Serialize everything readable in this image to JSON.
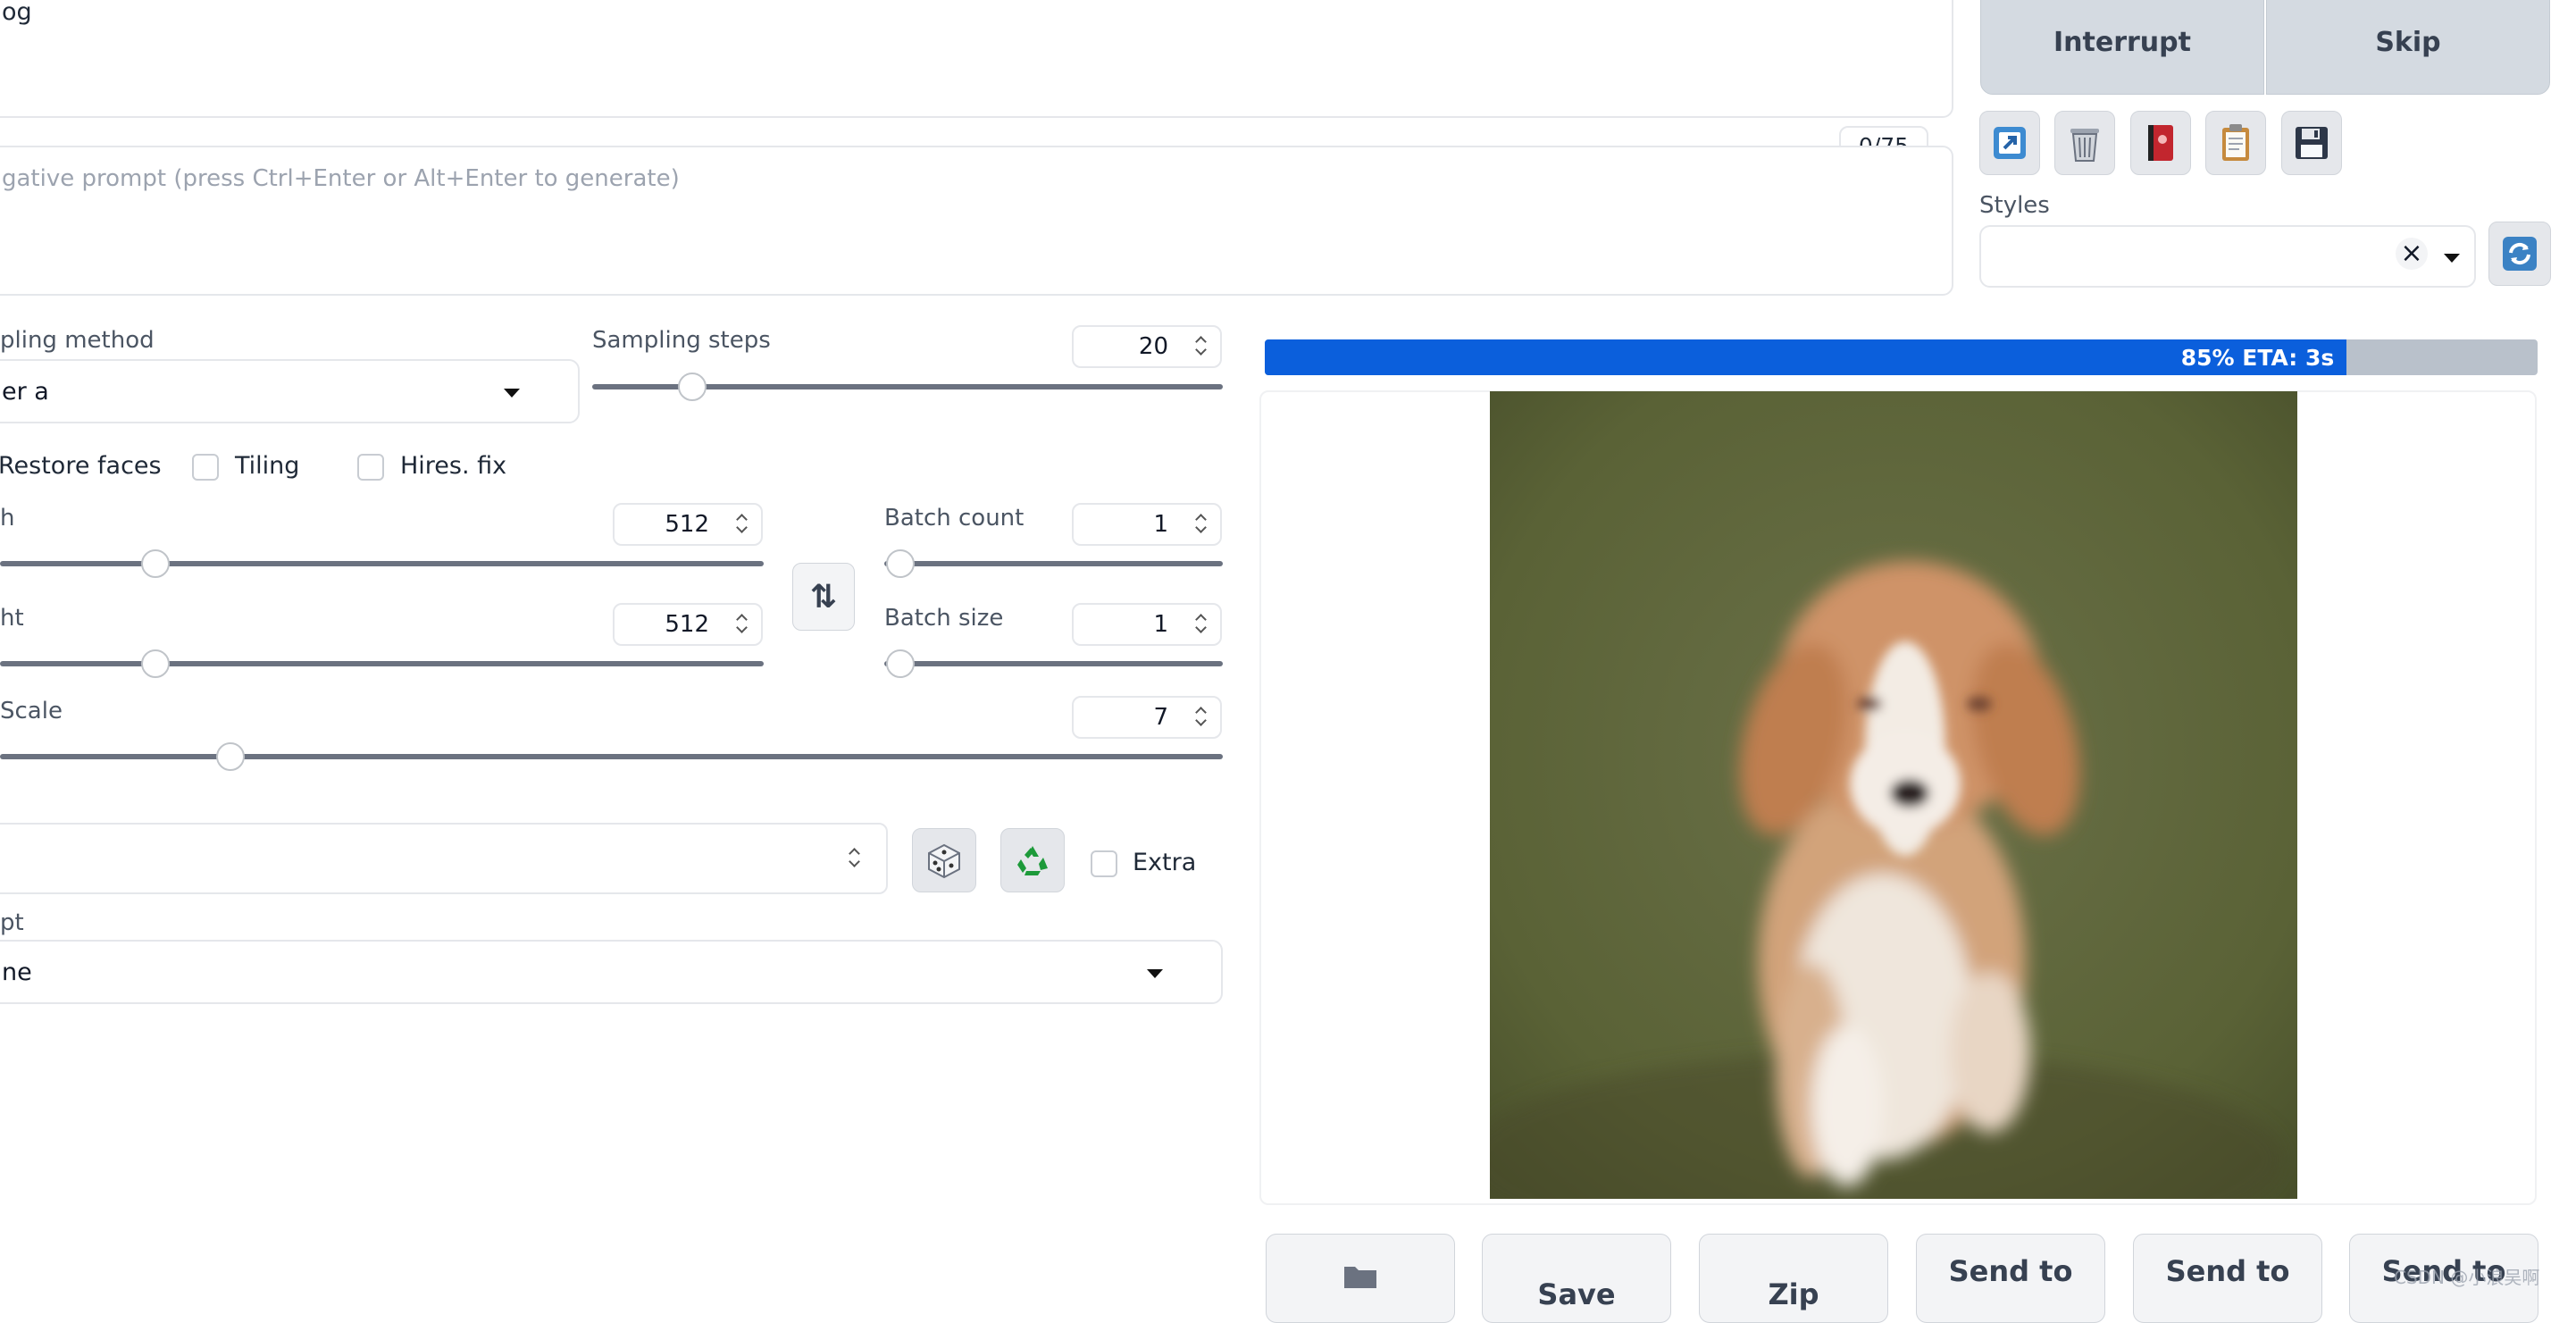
{
  "prompt": {
    "visible_text": "og",
    "negative_placeholder": "gative prompt (press Ctrl+Enter or Alt+Enter to generate)",
    "token_counter": "0/75"
  },
  "actions": {
    "interrupt": "Interrupt",
    "skip": "Skip"
  },
  "tools": [
    "arrow-icon",
    "trash-icon",
    "red-book-icon",
    "clipboard-icon",
    "floppy-disk-icon"
  ],
  "styles": {
    "label": "Styles",
    "clear_symbol": "×"
  },
  "sampling": {
    "method_label": "pling method",
    "method_value": "er a",
    "steps_label": "Sampling steps",
    "steps_value": "20",
    "steps_fraction": 0.14
  },
  "options": {
    "restore_faces": "Restore faces",
    "tiling": "Tiling",
    "hires_fix": "Hires. fix"
  },
  "size": {
    "width_label": "h",
    "width_value": "512",
    "width_fraction": 0.19,
    "height_label": "ht",
    "height_value": "512",
    "height_fraction": 0.19,
    "swap_symbol": "⇅"
  },
  "batch": {
    "count_label": "Batch count",
    "count_value": "1",
    "count_fraction": 0.0,
    "size_label": "Batch size",
    "size_value": "1",
    "size_fraction": 0.0
  },
  "cfg": {
    "label": "Scale",
    "value": "7",
    "fraction": 0.18
  },
  "seed": {
    "extra_label": "Extra"
  },
  "script": {
    "label": "pt",
    "value": "ne"
  },
  "progress": {
    "fraction": 0.85,
    "text": "85% ETA: 3s",
    "fill_color": "#0b5fdc",
    "track_color": "#b9c1cb"
  },
  "output_buttons": [
    "",
    "Save",
    "Zip",
    "Send to",
    "Send to",
    "Send to"
  ],
  "watermark": "CSDN @小浪吴啊"
}
